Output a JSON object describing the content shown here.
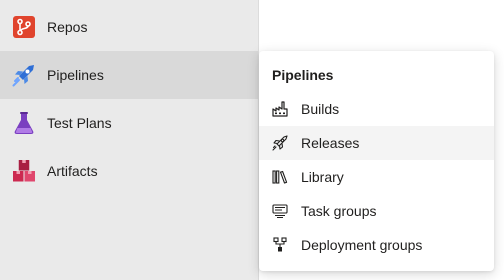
{
  "sidebar": {
    "items": [
      {
        "label": "Repos",
        "icon": "repos-icon"
      },
      {
        "label": "Pipelines",
        "icon": "pipelines-icon"
      },
      {
        "label": "Test Plans",
        "icon": "test-plans-icon"
      },
      {
        "label": "Artifacts",
        "icon": "artifacts-icon"
      }
    ],
    "selected": "Pipelines"
  },
  "flyout": {
    "title": "Pipelines",
    "items": [
      {
        "label": "Builds",
        "icon": "builds-icon"
      },
      {
        "label": "Releases",
        "icon": "rocket-icon"
      },
      {
        "label": "Library",
        "icon": "library-icon"
      },
      {
        "label": "Task groups",
        "icon": "task-groups-icon"
      },
      {
        "label": "Deployment groups",
        "icon": "deployment-groups-icon"
      }
    ],
    "hovered": "Releases"
  },
  "colors": {
    "repos": "#e0442d",
    "pipelines": "#2f6fd6",
    "test_plans": "#7a3fc0",
    "artifacts": "#cc2950"
  }
}
